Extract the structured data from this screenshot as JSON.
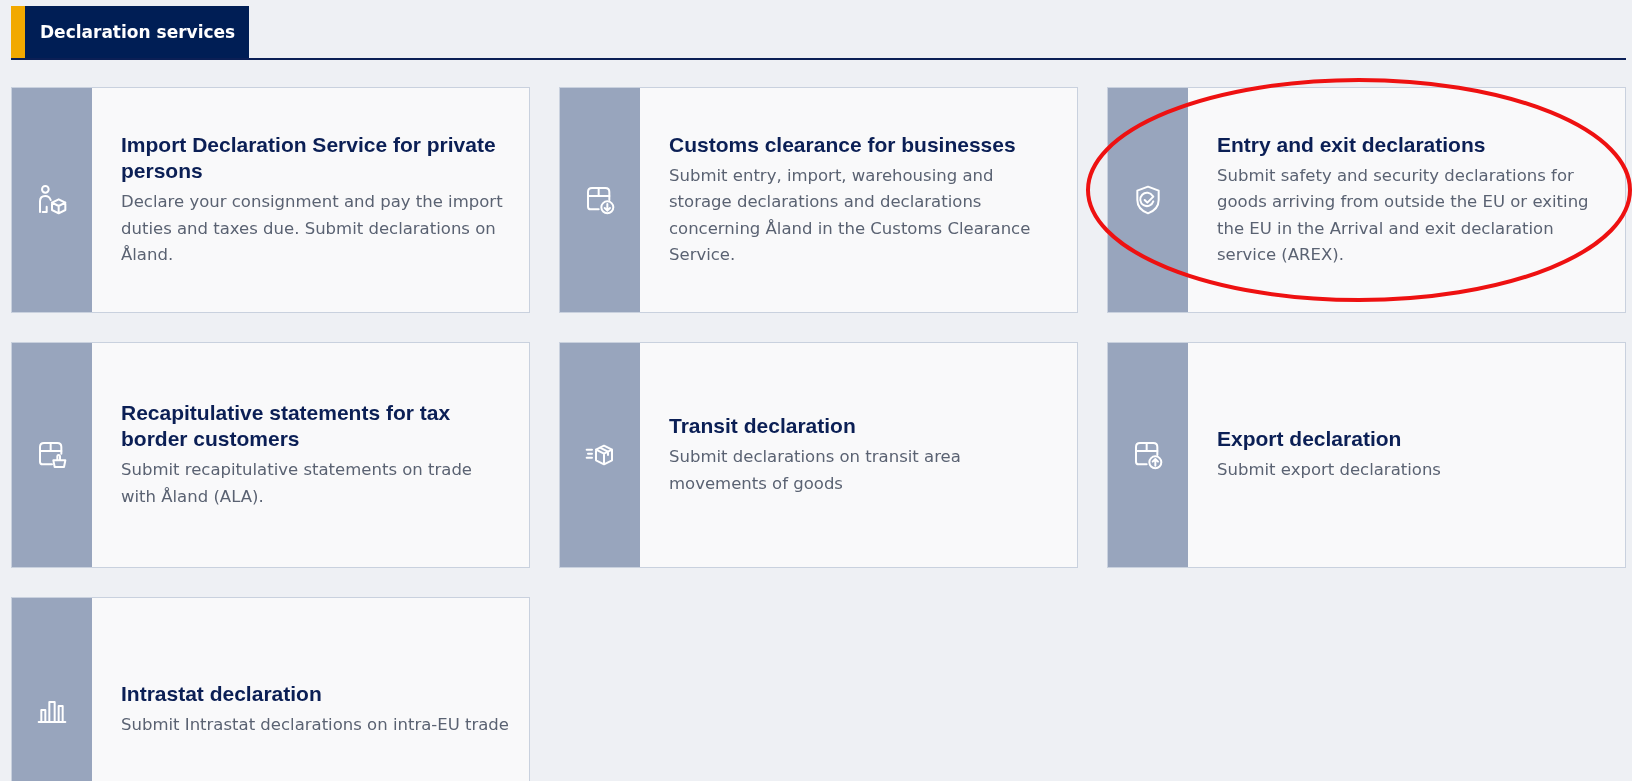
{
  "section_tab": {
    "label": "Declaration services",
    "selected": true
  },
  "cards": [
    {
      "title": "Import Declaration Service for private persons",
      "description": "Declare your consignment and pay the import duties and taxes due. Submit declarations on Åland.",
      "circled": false
    },
    {
      "title": "Customs clearance for businesses",
      "description": "Submit entry, import, warehousing and storage declarations and declarations concerning Åland in the Customs Clearance Service.",
      "circled": false
    },
    {
      "title": "Entry and exit declarations",
      "description": "Submit safety and security declarations for goods arriving from outside the EU or exiting the EU in the Arrival and exit declaration service (AREX).",
      "circled": true
    },
    {
      "title": "Recapitulative statements for tax border customers",
      "description": "Submit recapitulative statements on trade with Åland (ALA).",
      "circled": false
    },
    {
      "title": "Transit declaration",
      "description": "Submit declarations on transit area movements of goods",
      "circled": false
    },
    {
      "title": "Export declaration",
      "description": "Submit export declarations",
      "circled": false
    },
    {
      "title": "Intrastat declaration",
      "description": "Submit Intrastat declarations on intra-EU trade",
      "circled": false
    }
  ]
}
